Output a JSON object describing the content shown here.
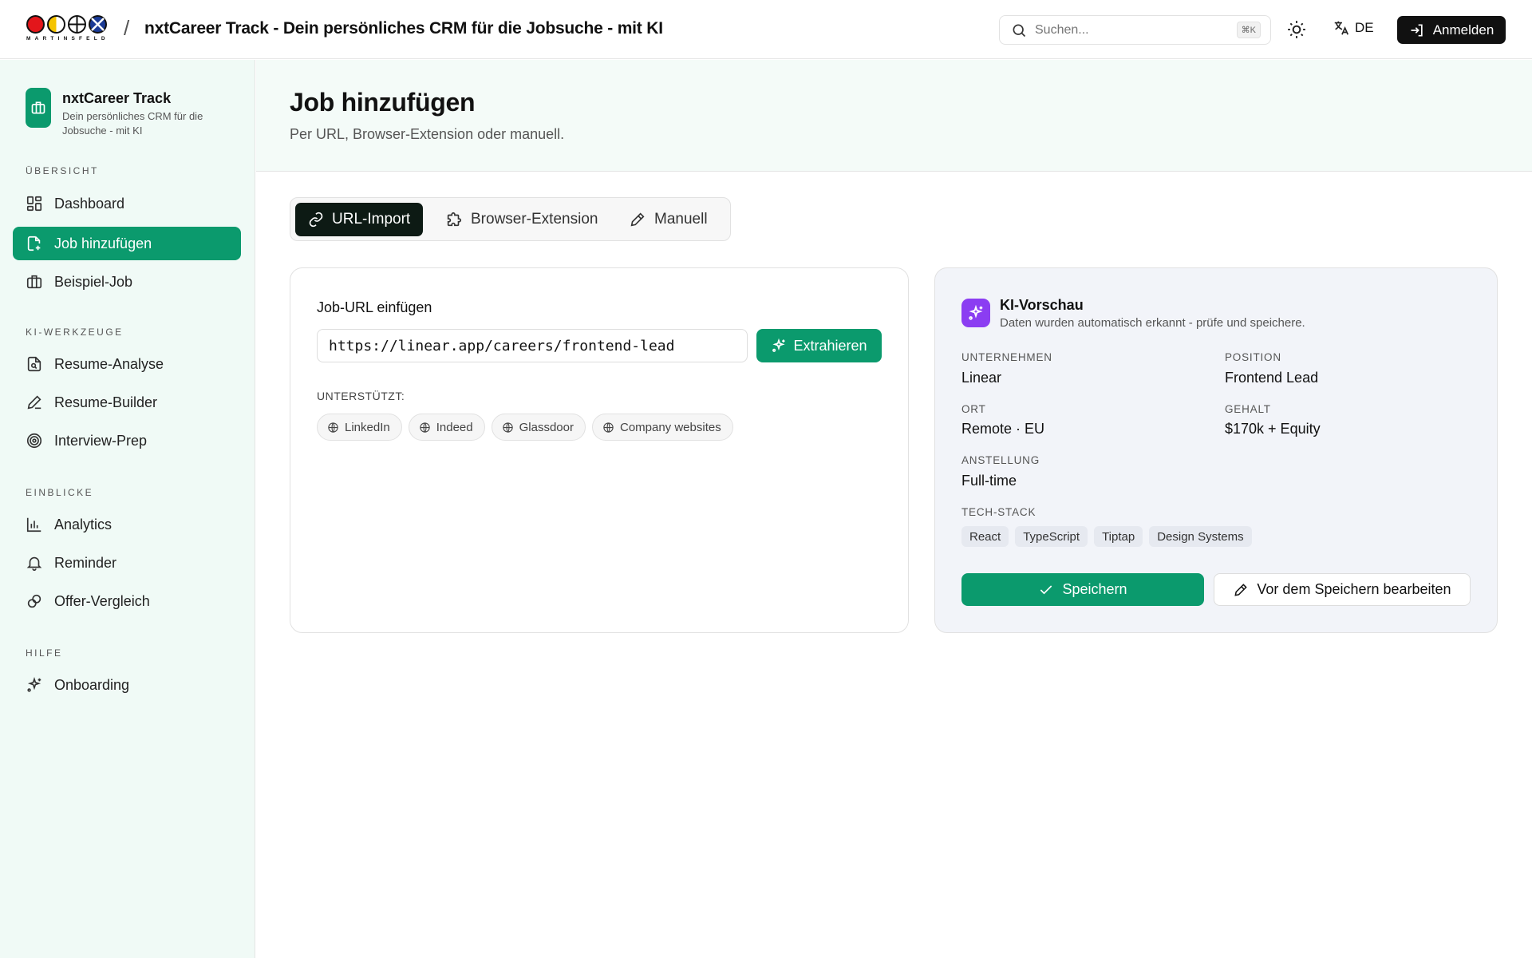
{
  "header": {
    "logo_text": "MARTINSFELD",
    "logo_colors": [
      "#e3161b",
      "#f5c400",
      "#ffffff",
      "#1b3b95"
    ],
    "separator": "/",
    "title": "nxtCareer Track - Dein persönliches CRM für die Jobsuche - mit KI",
    "search_placeholder": "Suchen...",
    "search_shortcut": "⌘K",
    "language": "DE",
    "login_label": "Anmelden"
  },
  "sidebar": {
    "brand_title": "nxtCareer Track",
    "brand_subtitle": "Dein persönliches CRM für die Jobsuche - mit KI",
    "sections": [
      {
        "label": "ÜBERSICHT",
        "items": [
          {
            "label": "Dashboard",
            "icon": "dashboard-icon",
            "active": false
          },
          {
            "label": "Job hinzufügen",
            "icon": "file-plus-icon",
            "active": true
          },
          {
            "label": "Beispiel-Job",
            "icon": "briefcase-icon",
            "active": false
          }
        ]
      },
      {
        "label": "KI-WERKZEUGE",
        "items": [
          {
            "label": "Resume-Analyse",
            "icon": "file-search-icon",
            "active": false
          },
          {
            "label": "Resume-Builder",
            "icon": "pen-icon",
            "active": false
          },
          {
            "label": "Interview-Prep",
            "icon": "target-icon",
            "active": false
          }
        ]
      },
      {
        "label": "EINBLICKE",
        "items": [
          {
            "label": "Analytics",
            "icon": "bar-chart-icon",
            "active": false
          },
          {
            "label": "Reminder",
            "icon": "bell-icon",
            "active": false
          },
          {
            "label": "Offer-Vergleich",
            "icon": "compare-icon",
            "active": false
          }
        ]
      },
      {
        "label": "HILFE",
        "items": [
          {
            "label": "Onboarding",
            "icon": "sparkles-icon",
            "active": false
          }
        ]
      }
    ]
  },
  "page": {
    "title": "Job hinzufügen",
    "subtitle": "Per URL, Browser-Extension oder manuell."
  },
  "tabs": [
    {
      "label": "URL-Import",
      "icon": "link-icon",
      "active": true
    },
    {
      "label": "Browser-Extension",
      "icon": "puzzle-icon",
      "active": false
    },
    {
      "label": "Manuell",
      "icon": "pencil-icon",
      "active": false
    }
  ],
  "url_import": {
    "label": "Job-URL einfügen",
    "url_value": "https://linear.app/careers/frontend-lead",
    "extract_label": "Extrahieren",
    "supported_label": "UNTERSTÜTZT:",
    "supported_sites": [
      "LinkedIn",
      "Indeed",
      "Glassdoor",
      "Company websites"
    ]
  },
  "preview": {
    "title": "KI-Vorschau",
    "subtitle": "Daten wurden automatisch erkannt - prüfe und speichere.",
    "fields": {
      "company": {
        "label": "UNTERNEHMEN",
        "value": "Linear"
      },
      "position": {
        "label": "POSITION",
        "value": "Frontend Lead"
      },
      "location": {
        "label": "ORT",
        "value": "Remote · EU"
      },
      "salary": {
        "label": "GEHALT",
        "value": "$170k + Equity"
      },
      "employment": {
        "label": "ANSTELLUNG",
        "value": "Full-time"
      }
    },
    "tech_stack_label": "TECH-STACK",
    "tech_stack": [
      "React",
      "TypeScript",
      "Tiptap",
      "Design Systems"
    ],
    "save_label": "Speichern",
    "edit_label": "Vor dem Speichern bearbeiten"
  },
  "colors": {
    "accent": "#0b9a6d",
    "ai_accent": "#8b3df2",
    "dark": "#111111"
  }
}
